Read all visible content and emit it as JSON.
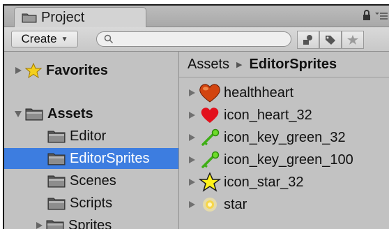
{
  "tab": {
    "title": "Project"
  },
  "toolbar": {
    "create_label": "Create",
    "search_value": "",
    "search_placeholder": ""
  },
  "left_tree": {
    "favorites_label": "Favorites",
    "assets_label": "Assets",
    "items": [
      {
        "label": "Editor"
      },
      {
        "label": "EditorSprites"
      },
      {
        "label": "Scenes"
      },
      {
        "label": "Scripts"
      },
      {
        "label": "Sprites"
      }
    ]
  },
  "breadcrumb": {
    "root": "Assets",
    "current": "EditorSprites"
  },
  "assets": [
    {
      "name": "healthheart",
      "icon": "health-heart-icon"
    },
    {
      "name": "icon_heart_32",
      "icon": "red-heart-icon"
    },
    {
      "name": "icon_key_green_32",
      "icon": "green-key-icon"
    },
    {
      "name": "icon_key_green_100",
      "icon": "green-key-icon"
    },
    {
      "name": "icon_star_32",
      "icon": "yellow-star-icon"
    },
    {
      "name": "star",
      "icon": "glow-star-icon"
    }
  ],
  "colors": {
    "selection": "#3d7de0",
    "panel": "#c2c2c2"
  }
}
